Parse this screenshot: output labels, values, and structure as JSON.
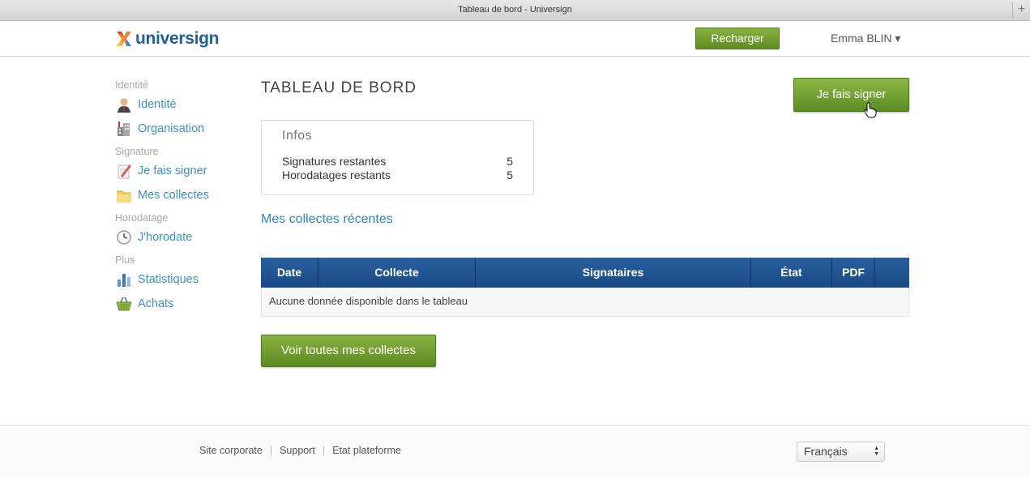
{
  "window": {
    "title": "Tableau de bord - Universign"
  },
  "header": {
    "logo_text": "universign",
    "recharge_label": "Recharger",
    "user_name": "Emma BLIN",
    "user_caret": "▾"
  },
  "sidebar": {
    "sections": [
      {
        "title": "Identité",
        "items": [
          {
            "label": "Identité",
            "icon": "user-icon"
          },
          {
            "label": "Organisation",
            "icon": "building-icon"
          }
        ]
      },
      {
        "title": "Signature",
        "items": [
          {
            "label": "Je fais signer",
            "icon": "document-pen-icon"
          },
          {
            "label": "Mes collectes",
            "icon": "folder-icon"
          }
        ]
      },
      {
        "title": "Horodatage",
        "items": [
          {
            "label": "J'horodate",
            "icon": "clock-icon"
          }
        ]
      },
      {
        "title": "Plus",
        "items": [
          {
            "label": "Statistiques",
            "icon": "bar-chart-icon"
          },
          {
            "label": "Achats",
            "icon": "basket-icon"
          }
        ]
      }
    ]
  },
  "main": {
    "title": "TABLEAU DE BORD",
    "sign_button_label": "Je fais signer",
    "infos": {
      "title": "Infos",
      "rows": [
        {
          "label": "Signatures restantes",
          "value": "5"
        },
        {
          "label": "Horodatages restants",
          "value": "5"
        }
      ]
    },
    "recent_title": "Mes collectes récentes",
    "table": {
      "columns": [
        "Date",
        "Collecte",
        "Signataires",
        "État",
        "PDF",
        ""
      ],
      "empty_message": "Aucune donnée disponible dans le tableau"
    },
    "view_all_label": "Voir toutes mes collectes"
  },
  "footer": {
    "links": [
      "Site corporate",
      "Support",
      "Etat plateforme"
    ],
    "separator": "|",
    "language": "Français"
  },
  "colors": {
    "accent_green": "#6f9a2e",
    "link_blue": "#3d8fc2",
    "table_header_blue": "#1f5594"
  }
}
